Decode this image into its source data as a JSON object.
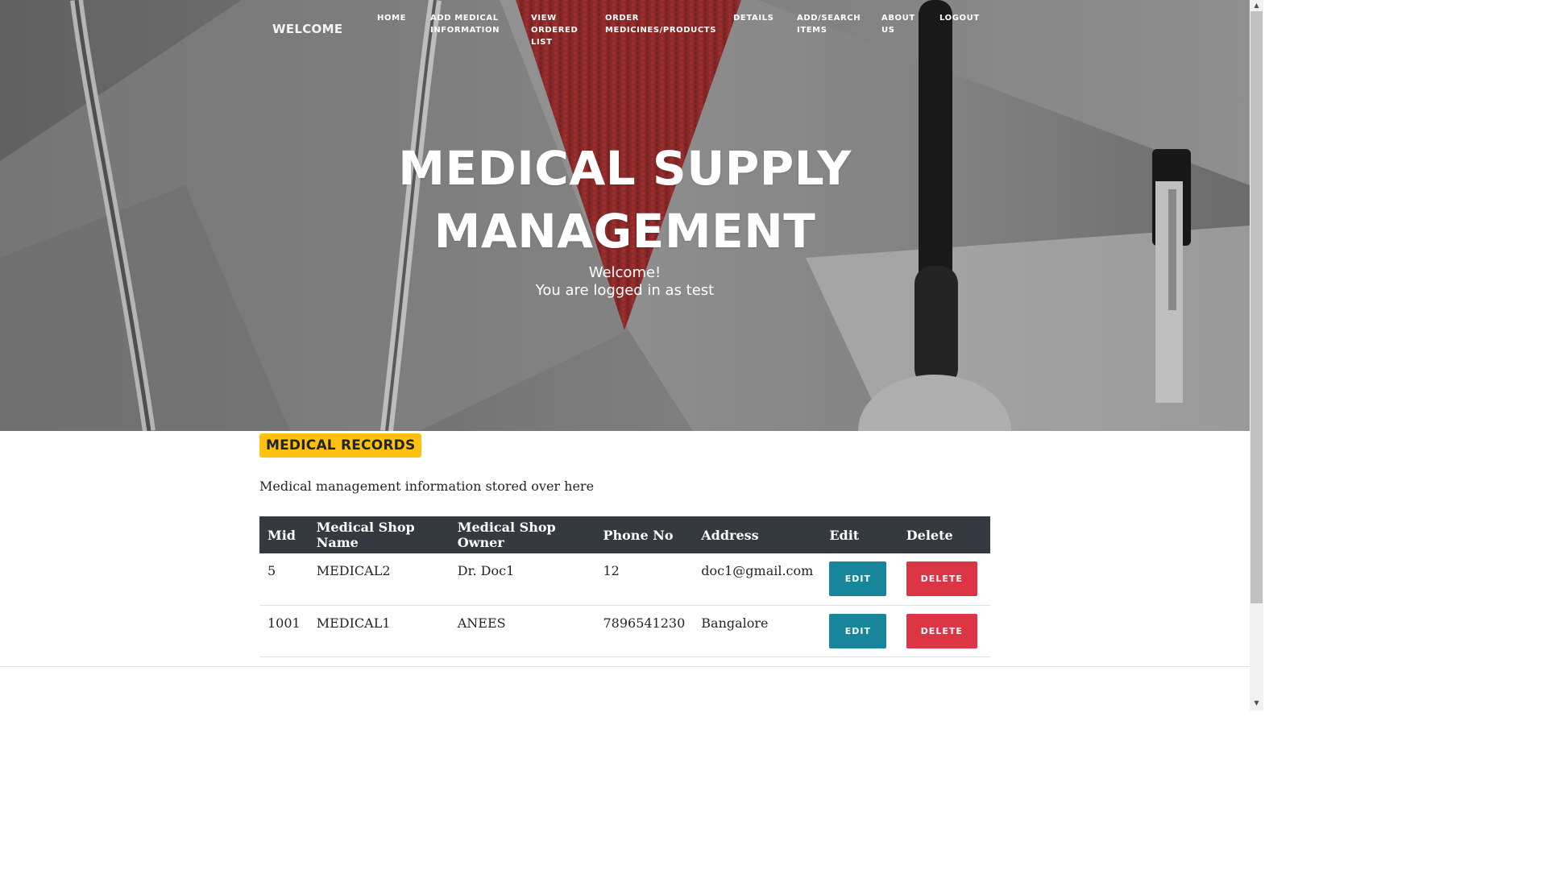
{
  "nav": {
    "brand": "WELCOME",
    "items": [
      {
        "lines": [
          "HOME"
        ]
      },
      {
        "lines": [
          "ADD MEDICAL",
          "INFORMATION"
        ]
      },
      {
        "lines": [
          "VIEW",
          "ORDERED",
          "LIST"
        ]
      },
      {
        "lines": [
          "ORDER",
          "MEDICINES/PRODUCTS"
        ]
      },
      {
        "lines": [
          "DETAILS"
        ]
      },
      {
        "lines": [
          "ADD/SEARCH",
          "ITEMS"
        ]
      },
      {
        "lines": [
          "ABOUT",
          "US"
        ]
      },
      {
        "lines": [
          "LOGOUT"
        ]
      }
    ]
  },
  "hero": {
    "title_line1": "MEDICAL SUPPLY",
    "title_line2": "MANAGEMENT",
    "welcome": "Welcome!",
    "logged_in": "You are logged in as test"
  },
  "records": {
    "heading": "MEDICAL RECORDS",
    "description": "Medical management information stored over here",
    "columns": [
      "Mid",
      "Medical Shop Name",
      "Medical Shop Owner",
      "Phone No",
      "Address",
      "Edit",
      "Delete"
    ],
    "rows": [
      {
        "mid": "5",
        "name": "MEDICAL2",
        "owner": "Dr. Doc1",
        "phone": "12",
        "address": "doc1@gmail.com"
      },
      {
        "mid": "1001",
        "name": "MEDICAL1",
        "owner": "ANEES",
        "phone": "7896541230",
        "address": "Bangalore"
      }
    ],
    "edit_label": "EDIT",
    "delete_label": "DELETE"
  },
  "colors": {
    "badge": "#fec10f",
    "table_header": "#343a40",
    "edit_button": "#17869b",
    "delete_button": "#dc3545"
  },
  "icons": {
    "scroll_up": "scroll-up-arrow-icon",
    "scroll_down": "scroll-down-arrow-icon"
  }
}
